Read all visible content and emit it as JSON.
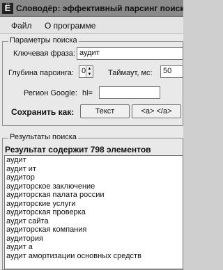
{
  "window": {
    "title": "Словодёр: эффективный парсинг поисковых"
  },
  "menu": {
    "items": [
      "Файл",
      "О программе"
    ]
  },
  "params": {
    "group_title": "Параметры поиска",
    "keyphrase_label": "Ключевая фраза:",
    "keyphrase_value": "аудит",
    "depth_label": "Глубина парсинга:",
    "depth_value": "0",
    "timeout_label": "Таймаут, мс:",
    "timeout_value": "50",
    "region_label": "Регион Google:",
    "region_prefix": "hl=",
    "region_value": "",
    "save_label": "Сохранить как:",
    "save_text_button": "Текст",
    "save_html_button": "<a> </a>"
  },
  "results": {
    "group_title": "Результаты поиска",
    "count_text": "Результат содержит 798 элементов",
    "items": [
      "аудит",
      "аудит ит",
      "аудитор",
      "аудиторское заключение",
      "аудиторская палата россии",
      "аудиторские услуги",
      "аудиторская проверка",
      "аудит сайта",
      "аудиторская компания",
      "аудитория",
      "аудит а",
      "аудит амортизации основных средств"
    ]
  }
}
